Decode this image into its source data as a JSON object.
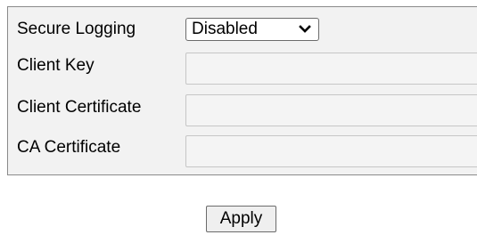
{
  "form": {
    "secure_logging": {
      "label": "Secure Logging",
      "selected": "Disabled"
    },
    "client_key": {
      "label": "Client Key",
      "value": ""
    },
    "client_certificate": {
      "label": "Client Certificate",
      "value": ""
    },
    "ca_certificate": {
      "label": "CA Certificate",
      "value": ""
    }
  },
  "actions": {
    "apply_label": "Apply"
  },
  "icons": {
    "dropdown": "chevron-down-icon"
  },
  "colors": {
    "panel_background": "#f2f2f2",
    "panel_border": "#8a8a8a",
    "input_background": "#f4f4f4",
    "input_border": "#c6c6c6",
    "button_background": "#efefef"
  }
}
